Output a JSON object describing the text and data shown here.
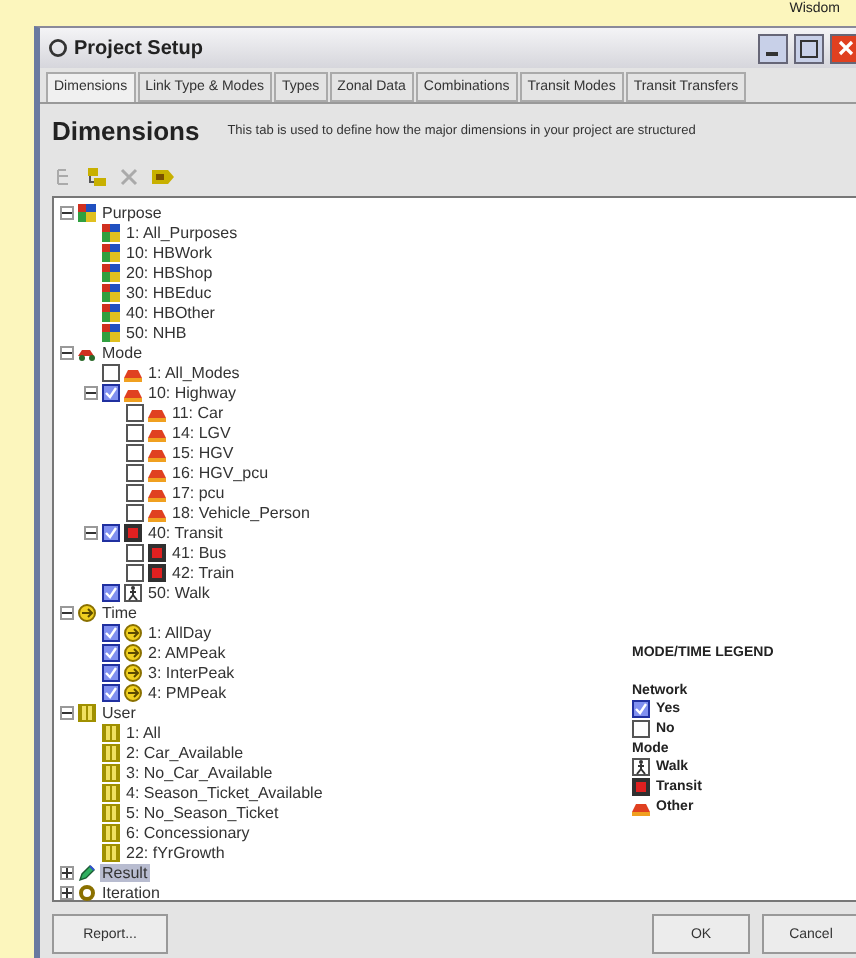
{
  "corner_label": "Wisdom",
  "window": {
    "title": "Project Setup"
  },
  "tabs": [
    {
      "label": "Dimensions",
      "selected": true
    },
    {
      "label": "Link Type & Modes",
      "selected": false
    },
    {
      "label": "Types",
      "selected": false
    },
    {
      "label": "Zonal Data",
      "selected": false
    },
    {
      "label": "Combinations",
      "selected": false
    },
    {
      "label": "Transit Modes",
      "selected": false
    },
    {
      "label": "Transit Transfers",
      "selected": false
    }
  ],
  "header": {
    "title": "Dimensions",
    "description": "This tab is used to define how the major dimensions in your project are structured"
  },
  "toolbar": [
    {
      "kind": "tree",
      "disabled": true
    },
    {
      "kind": "add",
      "disabled": false
    },
    {
      "kind": "delete",
      "disabled": true
    },
    {
      "kind": "tag",
      "disabled": false
    }
  ],
  "tree": [
    {
      "label": "Purpose",
      "kind": "purpose",
      "expanded": true,
      "selected": false,
      "children": [
        {
          "label": "1: All_Purposes",
          "kind": "purpose",
          "selected": false
        },
        {
          "label": "10: HBWork",
          "kind": "purpose",
          "selected": false
        },
        {
          "label": "20: HBShop",
          "kind": "purpose",
          "selected": false
        },
        {
          "label": "30: HBEduc",
          "kind": "purpose",
          "selected": false
        },
        {
          "label": "40: HBOther",
          "kind": "purpose",
          "selected": false
        },
        {
          "label": "50: NHB",
          "kind": "purpose",
          "selected": false
        }
      ]
    },
    {
      "label": "Mode",
      "kind": "mode",
      "expanded": true,
      "selected": false,
      "children": [
        {
          "label": "1: All_Modes",
          "kind": "other",
          "network": false,
          "selected": false
        },
        {
          "label": "10: Highway",
          "kind": "other",
          "network": true,
          "expanded": true,
          "selected": false,
          "children": [
            {
              "label": "11: Car",
              "kind": "other",
              "network": false,
              "selected": false
            },
            {
              "label": "14: LGV",
              "kind": "other",
              "network": false,
              "selected": false
            },
            {
              "label": "15: HGV",
              "kind": "other",
              "network": false,
              "selected": false
            },
            {
              "label": "16: HGV_pcu",
              "kind": "other",
              "network": false,
              "selected": false
            },
            {
              "label": "17: pcu",
              "kind": "other",
              "network": false,
              "selected": false
            },
            {
              "label": "18: Vehicle_Person",
              "kind": "other",
              "network": false,
              "selected": false
            }
          ]
        },
        {
          "label": "40: Transit",
          "kind": "transit",
          "network": true,
          "expanded": true,
          "selected": false,
          "children": [
            {
              "label": "41: Bus",
              "kind": "transit",
              "network": false,
              "selected": false
            },
            {
              "label": "42: Train",
              "kind": "transit",
              "network": false,
              "selected": false
            }
          ]
        },
        {
          "label": "50: Walk",
          "kind": "walk",
          "network": true,
          "selected": false
        }
      ]
    },
    {
      "label": "Time",
      "kind": "time",
      "expanded": true,
      "selected": false,
      "children": [
        {
          "label": "1: AllDay",
          "kind": "time",
          "network": true,
          "selected": false
        },
        {
          "label": "2: AMPeak",
          "kind": "time",
          "network": true,
          "selected": false
        },
        {
          "label": "3: InterPeak",
          "kind": "time",
          "network": true,
          "selected": false
        },
        {
          "label": "4: PMPeak",
          "kind": "time",
          "network": true,
          "selected": false
        }
      ]
    },
    {
      "label": "User",
      "kind": "user",
      "expanded": true,
      "selected": false,
      "children": [
        {
          "label": "1: All",
          "kind": "user",
          "selected": false
        },
        {
          "label": "2: Car_Available",
          "kind": "user",
          "selected": false
        },
        {
          "label": "3: No_Car_Available",
          "kind": "user",
          "selected": false
        },
        {
          "label": "4: Season_Ticket_Available",
          "kind": "user",
          "selected": false
        },
        {
          "label": "5: No_Season_Ticket",
          "kind": "user",
          "selected": false
        },
        {
          "label": "6: Concessionary",
          "kind": "user",
          "selected": false
        },
        {
          "label": "22: fYrGrowth",
          "kind": "user",
          "selected": false
        }
      ]
    },
    {
      "label": "Result",
      "kind": "result",
      "expanded": false,
      "selected": true
    },
    {
      "label": "Iteration",
      "kind": "iteration",
      "expanded": false,
      "selected": false
    }
  ],
  "legend": {
    "title": "MODE/TIME LEGEND",
    "sections": [
      {
        "heading": "Network",
        "items": [
          {
            "label": "Yes",
            "kind": "network_yes"
          },
          {
            "label": "No",
            "kind": "network_no"
          }
        ]
      },
      {
        "heading": "Mode",
        "items": [
          {
            "label": "Walk",
            "kind": "walk"
          },
          {
            "label": "Transit",
            "kind": "transit"
          },
          {
            "label": "Other",
            "kind": "other"
          }
        ]
      }
    ]
  },
  "buttons": [
    {
      "label": "Report...",
      "kind": "left"
    },
    {
      "label": "OK",
      "kind": "right"
    },
    {
      "label": "Cancel",
      "kind": "right"
    }
  ]
}
